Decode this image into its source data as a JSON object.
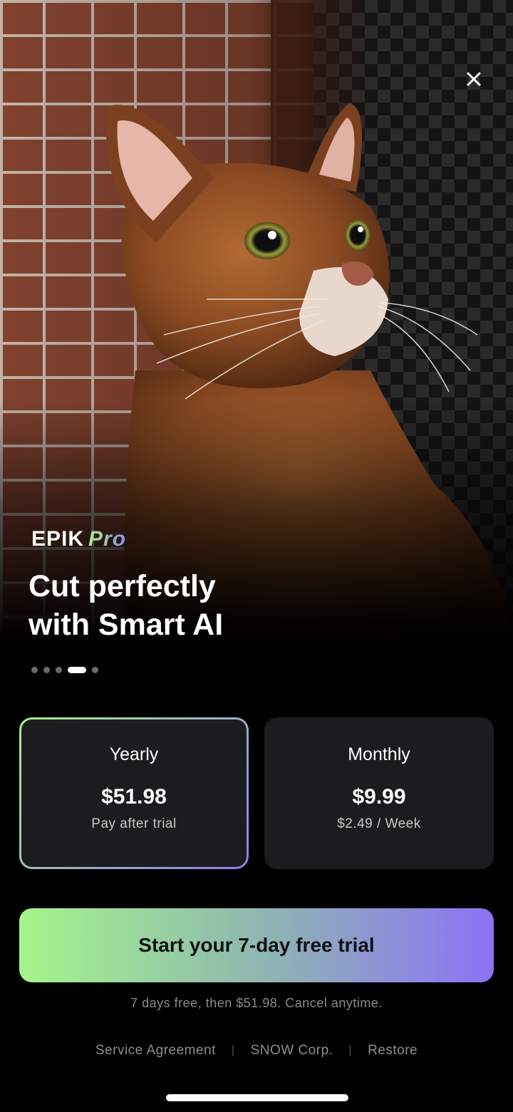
{
  "header": {
    "close_icon": "close-icon"
  },
  "brand": {
    "name": "EPIK",
    "tier": "Pro"
  },
  "headline": "Cut perfectly\nwith Smart AI",
  "carousel": {
    "total": 5,
    "active_index": 3
  },
  "plans": [
    {
      "name": "Yearly",
      "price": "$51.98",
      "subtext": "Pay after trial",
      "selected": true
    },
    {
      "name": "Monthly",
      "price": "$9.99",
      "subtext": "$2.49 / Week",
      "selected": false
    }
  ],
  "cta": {
    "label": "Start your 7-day free trial"
  },
  "fineprint": "7 days free, then $51.98. Cancel anytime.",
  "footer": {
    "links": [
      "Service Agreement",
      "SNOW Corp.",
      "Restore"
    ],
    "separator": "|"
  },
  "colors": {
    "gradient_start": "#a6f18a",
    "gradient_end": "#8c72f5",
    "card_bg": "#1c1c1e"
  }
}
